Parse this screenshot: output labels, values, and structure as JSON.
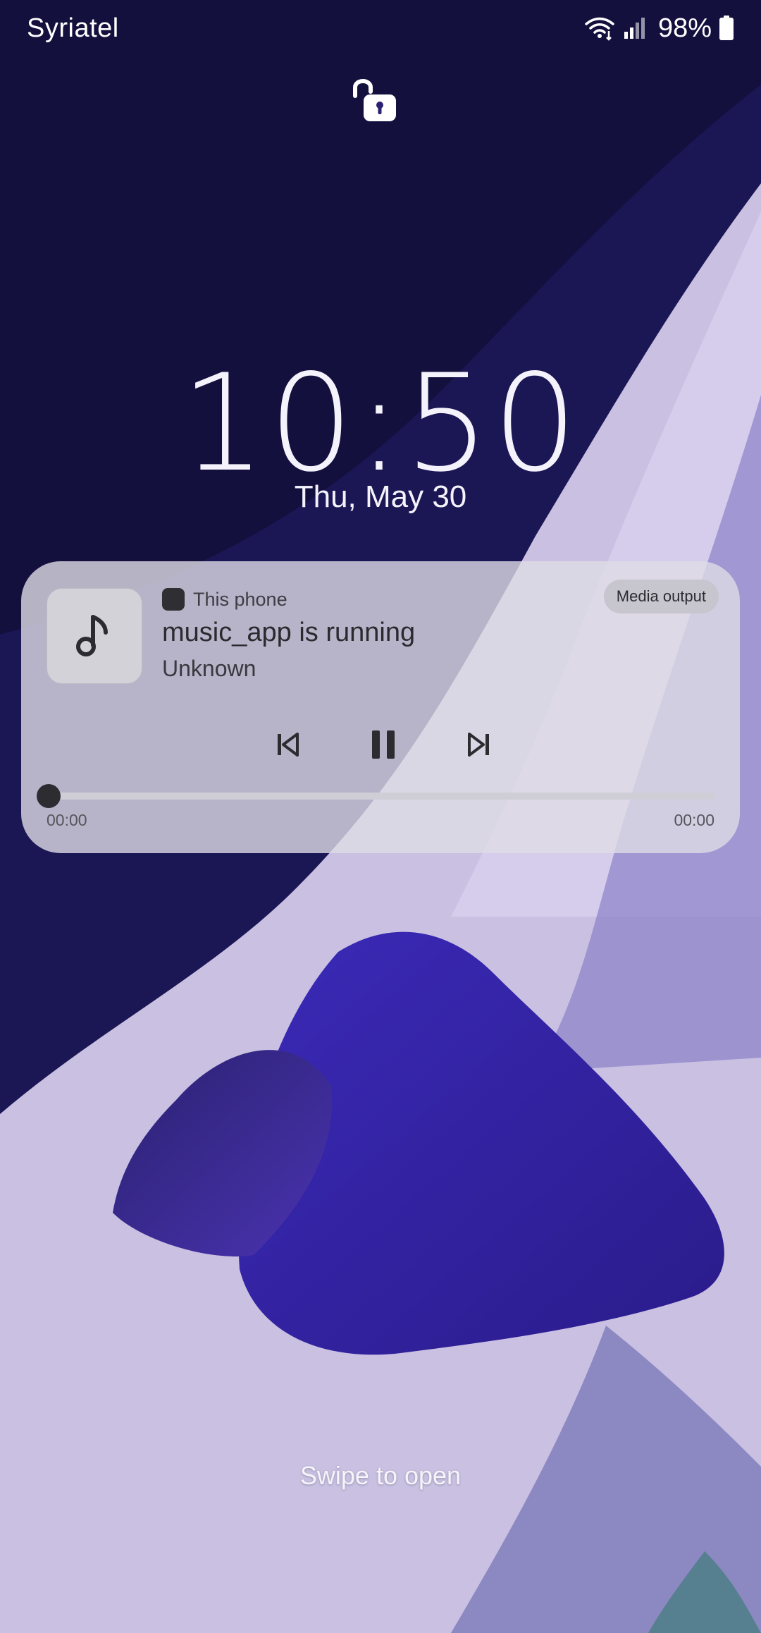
{
  "status_bar": {
    "carrier": "Syriatel",
    "battery_percent": "98%",
    "icons": [
      "wifi-icon",
      "signal-icon",
      "battery-icon"
    ]
  },
  "lock": {
    "icon": "unlock-icon"
  },
  "clock": {
    "time": "10:50",
    "date": "Thu, May 30"
  },
  "media": {
    "source_label": "This phone",
    "output_button_label": "Media output",
    "title": "music_app is running",
    "artist": "Unknown",
    "elapsed": "00:00",
    "duration": "00:00",
    "progress": 0,
    "controls": [
      "previous-icon",
      "pause-icon",
      "next-icon"
    ],
    "album_art_icon": "music-note-icon"
  },
  "footer": {
    "hint": "Swipe to open"
  },
  "colors": {
    "card_background": "#dedce6",
    "wallpaper_dark": "#1a1552",
    "wallpaper_light": "#cfc6e6",
    "accent_purple": "#4a2fc0"
  }
}
